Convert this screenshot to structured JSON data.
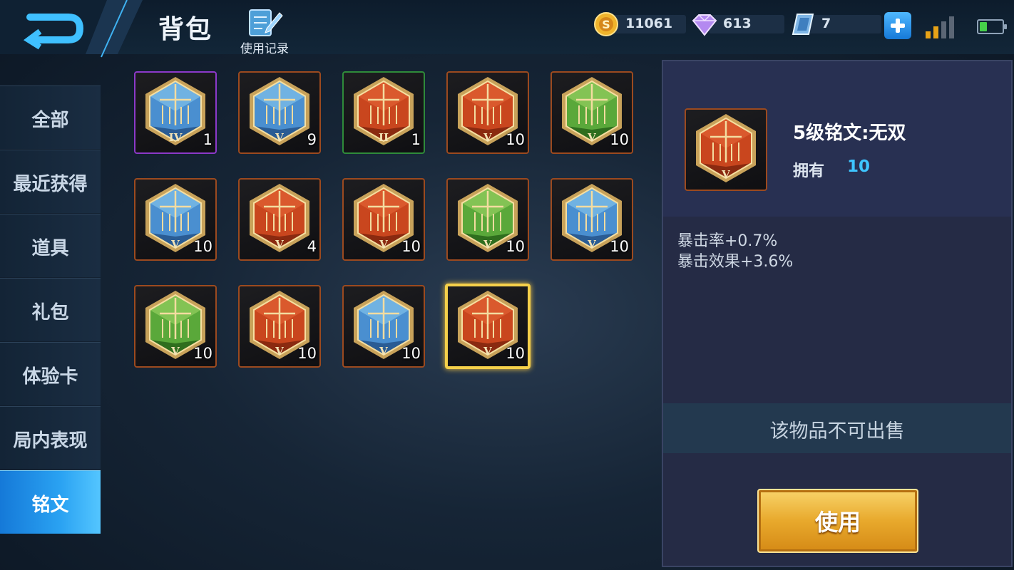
{
  "header": {
    "title": "背包",
    "usage_log_label": "使用记录",
    "gold": "11061",
    "diamonds": "613",
    "vouchers": "7"
  },
  "colors": {
    "accent_blue": "#2aa2f2",
    "own_value": "#3ec4ff",
    "gold_button": "#e8a92c",
    "rarity_orange": "#9c4a1f",
    "rarity_purple": "#8c39c9",
    "rarity_green": "#2f8b3a",
    "selected_border": "#f5d04a"
  },
  "sidebar": {
    "items": [
      {
        "label": "全部"
      },
      {
        "label": "最近获得"
      },
      {
        "label": "道具"
      },
      {
        "label": "礼包"
      },
      {
        "label": "体验卡"
      },
      {
        "label": "局内表现"
      },
      {
        "label": "铭文",
        "active": true
      }
    ]
  },
  "grid": {
    "items": [
      {
        "level": "IV",
        "qty": "1",
        "color": "blue",
        "frame": "purple"
      },
      {
        "level": "V",
        "qty": "9",
        "color": "blue",
        "frame": "orange"
      },
      {
        "level": "II",
        "qty": "1",
        "color": "red",
        "frame": "green"
      },
      {
        "level": "V",
        "qty": "10",
        "color": "red",
        "frame": "orange"
      },
      {
        "level": "V",
        "qty": "10",
        "color": "green",
        "frame": "orange"
      },
      {
        "level": "V",
        "qty": "10",
        "color": "blue",
        "frame": "orange"
      },
      {
        "level": "V",
        "qty": "4",
        "color": "red",
        "frame": "orange"
      },
      {
        "level": "V",
        "qty": "10",
        "color": "red",
        "frame": "orange"
      },
      {
        "level": "V",
        "qty": "10",
        "color": "green",
        "frame": "orange"
      },
      {
        "level": "V",
        "qty": "10",
        "color": "blue",
        "frame": "orange"
      },
      {
        "level": "V",
        "qty": "10",
        "color": "green",
        "frame": "orange"
      },
      {
        "level": "V",
        "qty": "10",
        "color": "red",
        "frame": "orange"
      },
      {
        "level": "V",
        "qty": "10",
        "color": "blue",
        "frame": "orange"
      },
      {
        "level": "V",
        "qty": "10",
        "color": "red",
        "frame": "orange",
        "selected": true
      }
    ]
  },
  "detail": {
    "item_name": "5级铭文:无双",
    "level": "V",
    "own_label": "拥有",
    "own_value": "10",
    "stats": [
      "暴击率+0.7%",
      "暴击效果+3.6%"
    ],
    "notice": "该物品不可出售",
    "use_button": "使用"
  }
}
